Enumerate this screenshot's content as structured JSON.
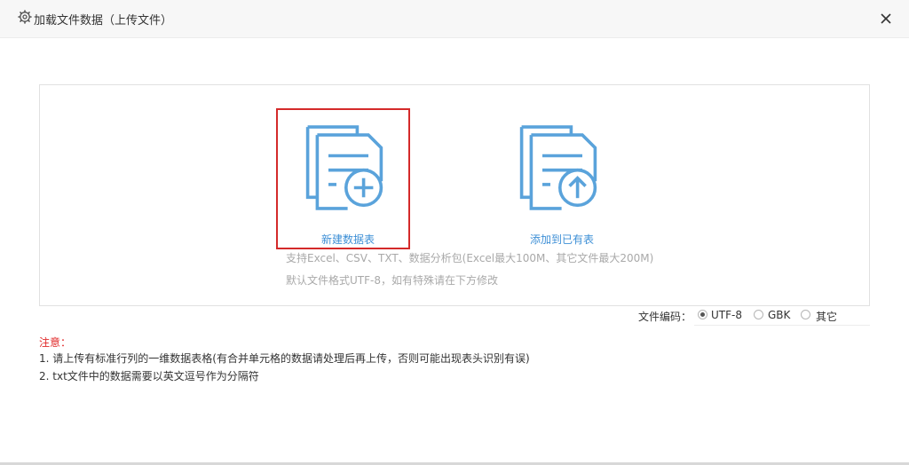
{
  "dialog": {
    "title": "加载文件数据（上传文件）",
    "close_icon": "close-icon",
    "settings_icon": "gear-icon"
  },
  "upload": {
    "options": [
      {
        "label": "新建数据表",
        "icon": "new-table-icon",
        "selected": true
      },
      {
        "label": "添加到已有表",
        "icon": "append-table-icon",
        "selected": false
      }
    ],
    "hint_formats": "支持Excel、CSV、TXT、数据分析包(Excel最大100M、其它文件最大200M)",
    "hint_encoding": "默认文件格式UTF-8，如有特殊请在下方修改"
  },
  "encoding": {
    "label": "文件编码：",
    "options": [
      "UTF-8",
      "GBK",
      "其它"
    ],
    "selected": "UTF-8"
  },
  "notes": {
    "title": "注意：",
    "lines": [
      "1. 请上传有标准行列的一维数据表格(有合并单元格的数据请处理后再上传，否则可能出现表头识别有误)",
      "2. txt文件中的数据需要以英文逗号作为分隔符"
    ]
  },
  "colors": {
    "accent": "#3d8fd6",
    "icon_stroke": "#5aa3db",
    "selected_border": "#d42a2a",
    "note_title": "#e12a2a",
    "hint_text": "#a9a9a9"
  }
}
